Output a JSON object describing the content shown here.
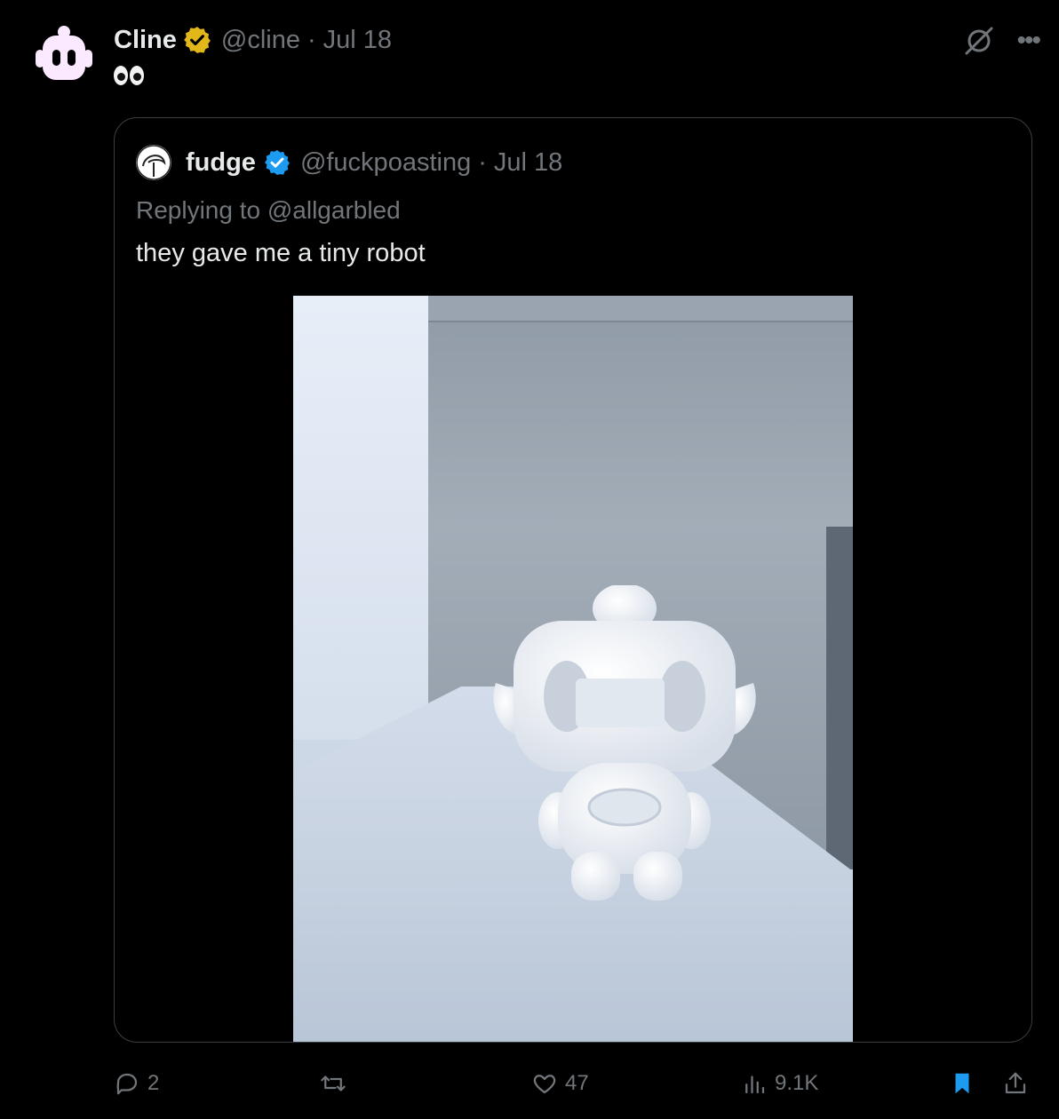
{
  "tweet": {
    "author_name": "Cline",
    "handle": "@cline",
    "separator": "·",
    "date": "Jul 18",
    "text_emoji": "eyes-emoji"
  },
  "quote": {
    "author_name": "fudge",
    "handle": "@fuckpoasting",
    "separator": "·",
    "date": "Jul 18",
    "replying_to": "Replying to @allgarbled",
    "text": "they gave me a tiny robot"
  },
  "actions": {
    "replies": "2",
    "likes": "47",
    "views": "9.1K"
  },
  "colors": {
    "background": "#000000",
    "text_primary": "#e7e9ea",
    "text_secondary": "#71767b",
    "gold_badge": "#e2b719",
    "blue_badge": "#1d9bf0",
    "bookmark_blue": "#1d9bf0"
  }
}
